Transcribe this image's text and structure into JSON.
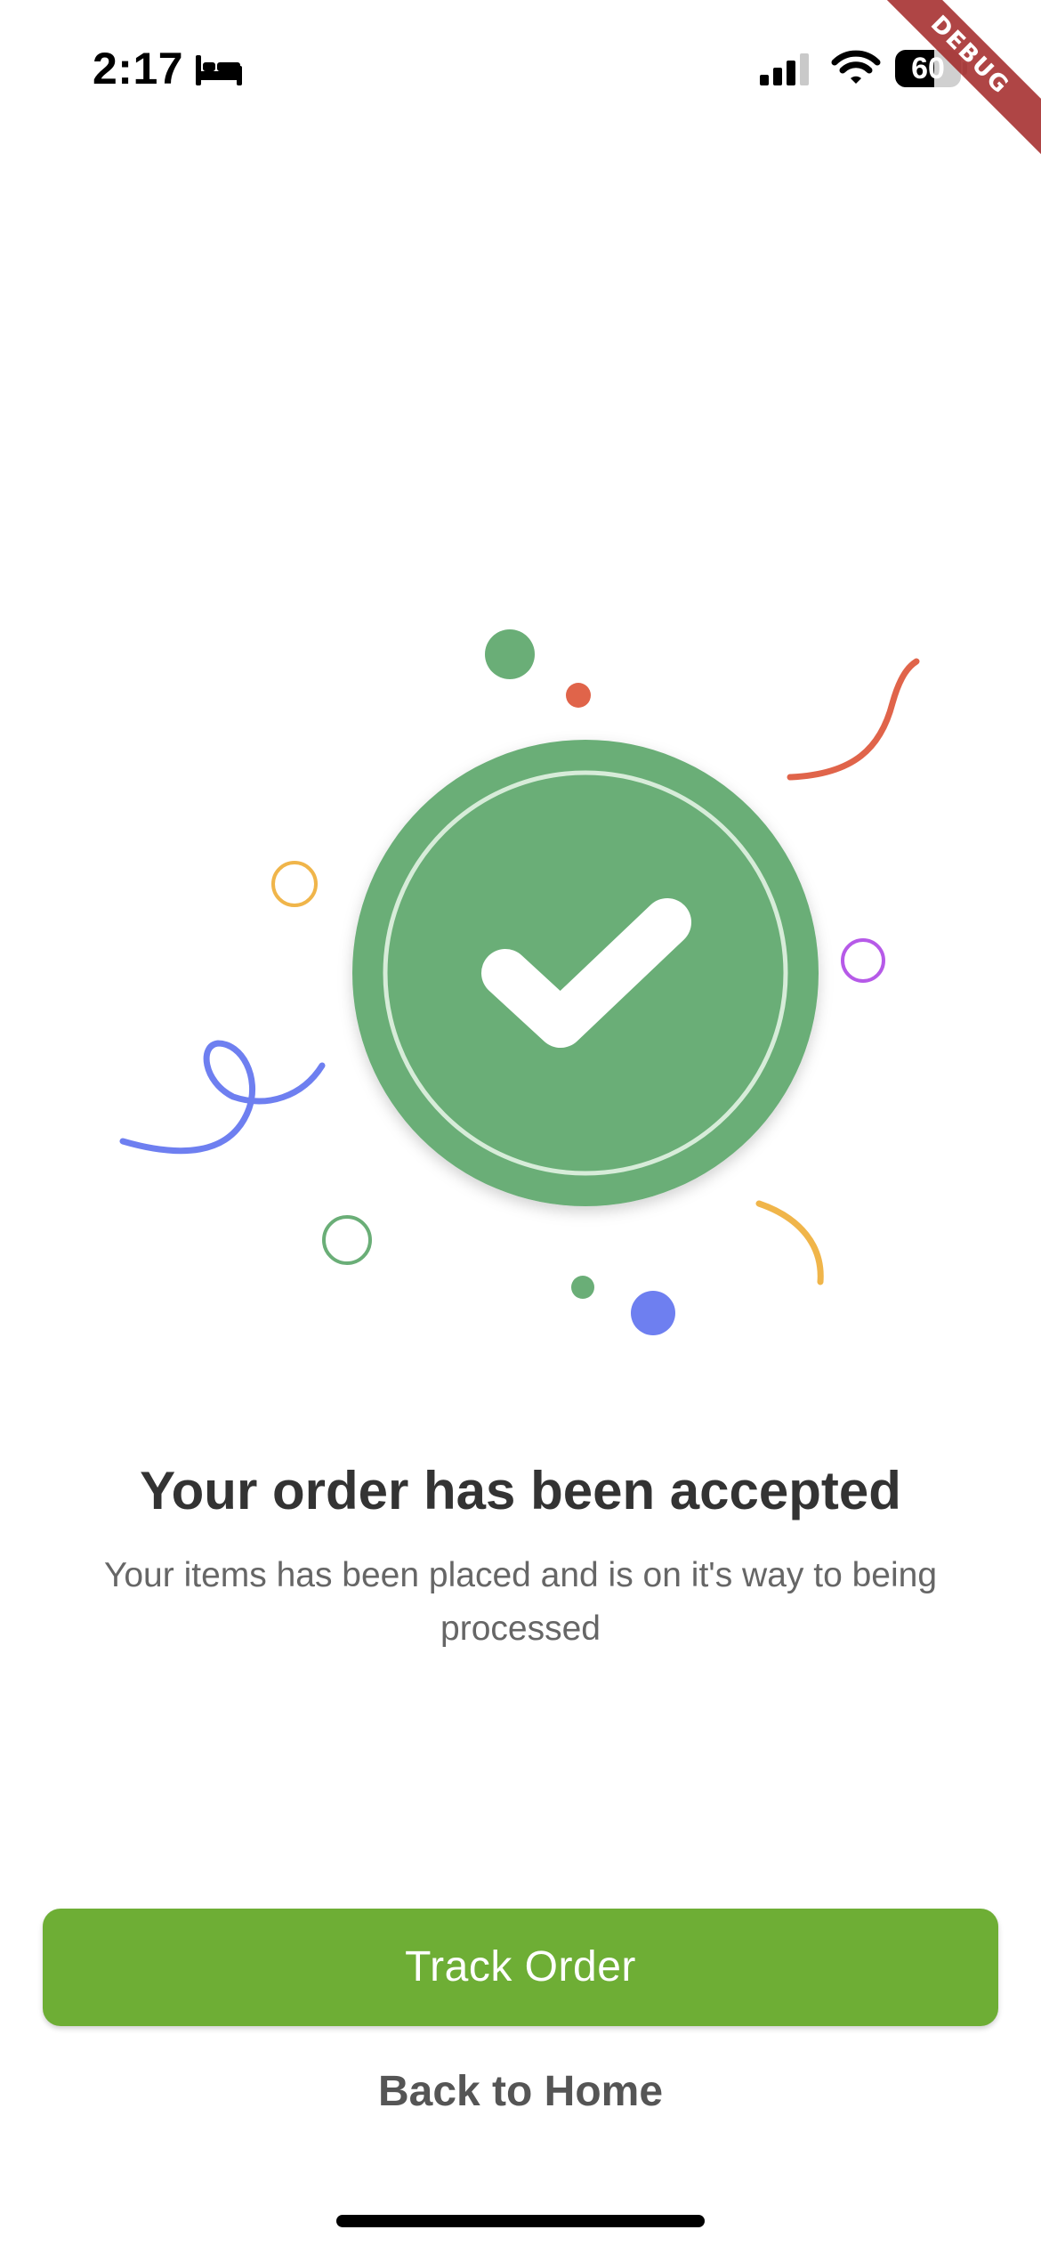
{
  "status_bar": {
    "time": "2:17",
    "battery_level": "60",
    "battery_fraction": 0.6,
    "icons": [
      "bed-icon",
      "cellular-signal-icon",
      "wifi-icon",
      "battery-icon"
    ]
  },
  "debug_banner": {
    "label": "DEBUG",
    "color": "#a12525"
  },
  "illustration": {
    "icon": "checkmark-icon",
    "badge_color": "#6aae77"
  },
  "content": {
    "title": "Your order has been accepted",
    "subtitle": "Your items has been placed and is on it's way to being processed"
  },
  "actions": {
    "primary_label": "Track Order",
    "primary_color": "#6eae35",
    "secondary_label": "Back to Home"
  }
}
